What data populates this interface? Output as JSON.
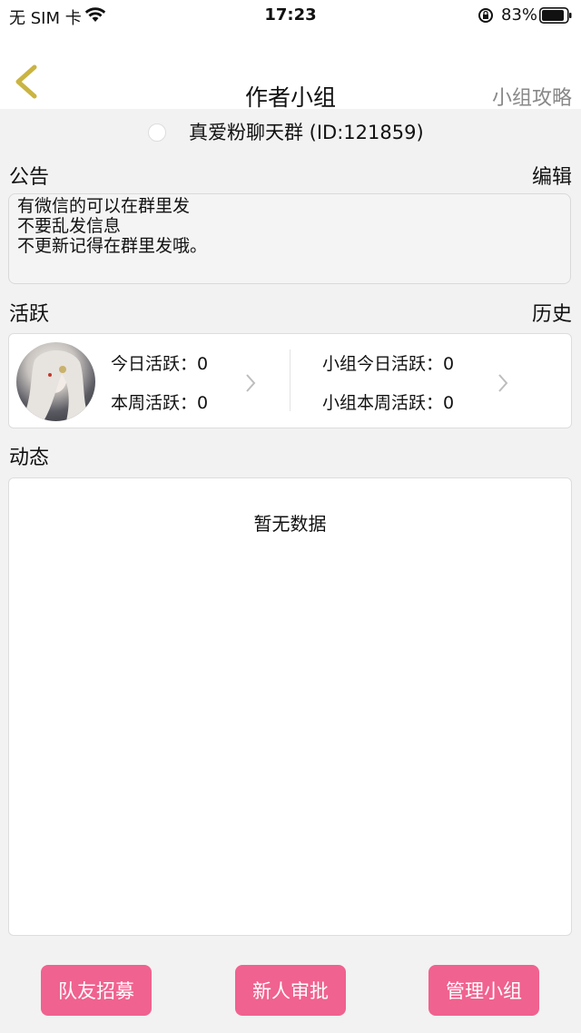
{
  "status_bar": {
    "carrier": "无 SIM 卡",
    "time": "17:23",
    "battery": "83%",
    "icons": [
      "wifi-icon",
      "orientation-lock-icon",
      "battery-icon"
    ]
  },
  "nav": {
    "title": "作者小组",
    "right_link": "小组攻略",
    "back_icon": "chevron-left-icon"
  },
  "group": {
    "name": "真爱粉聊天群 (ID:121859)"
  },
  "notice": {
    "label": "公告",
    "edit": "编辑",
    "lines": [
      "有微信的可以在群里发",
      "不要乱发信息",
      "不更新记得在群里发哦。"
    ]
  },
  "activity": {
    "label": "活跃",
    "history": "历史",
    "today": "今日活跃：0",
    "week": "本周活跃：0",
    "group_today": "小组今日活跃：0",
    "group_week": "小组本周活跃：0"
  },
  "feed": {
    "label": "动态",
    "empty": "暂无数据"
  },
  "buttons": {
    "recruit": "队友招募",
    "review": "新人审批",
    "manage": "管理小组"
  },
  "colors": {
    "accent_button": "#f0628f",
    "back_arrow": "#c9b443",
    "background": "#f2f2f2"
  }
}
